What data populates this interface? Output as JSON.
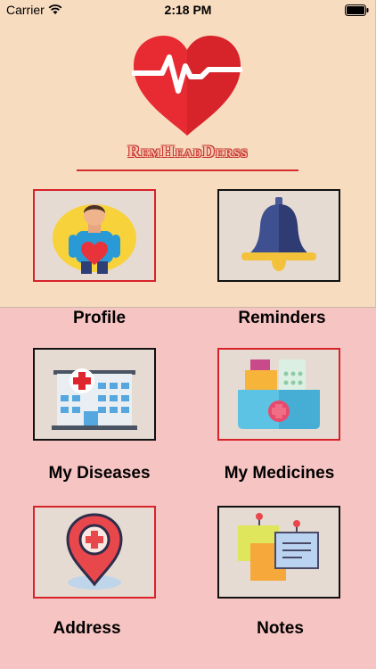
{
  "status_bar": {
    "carrier": "Carrier",
    "time": "2:18 PM"
  },
  "app": {
    "title": "RemHeadDerss"
  },
  "menu": [
    {
      "label": "Profile",
      "icon": "profile-icon"
    },
    {
      "label": "Reminders",
      "icon": "bell-icon"
    },
    {
      "label": "My Diseases",
      "icon": "hospital-icon"
    },
    {
      "label": "My Medicines",
      "icon": "medicine-box-icon"
    },
    {
      "label": "Address",
      "icon": "location-pin-icon"
    },
    {
      "label": "Notes",
      "icon": "sticky-notes-icon"
    }
  ],
  "colors": {
    "accent": "#d8232a",
    "top_background": "#f7dcc0",
    "bottom_background": "#f6c4c2"
  }
}
